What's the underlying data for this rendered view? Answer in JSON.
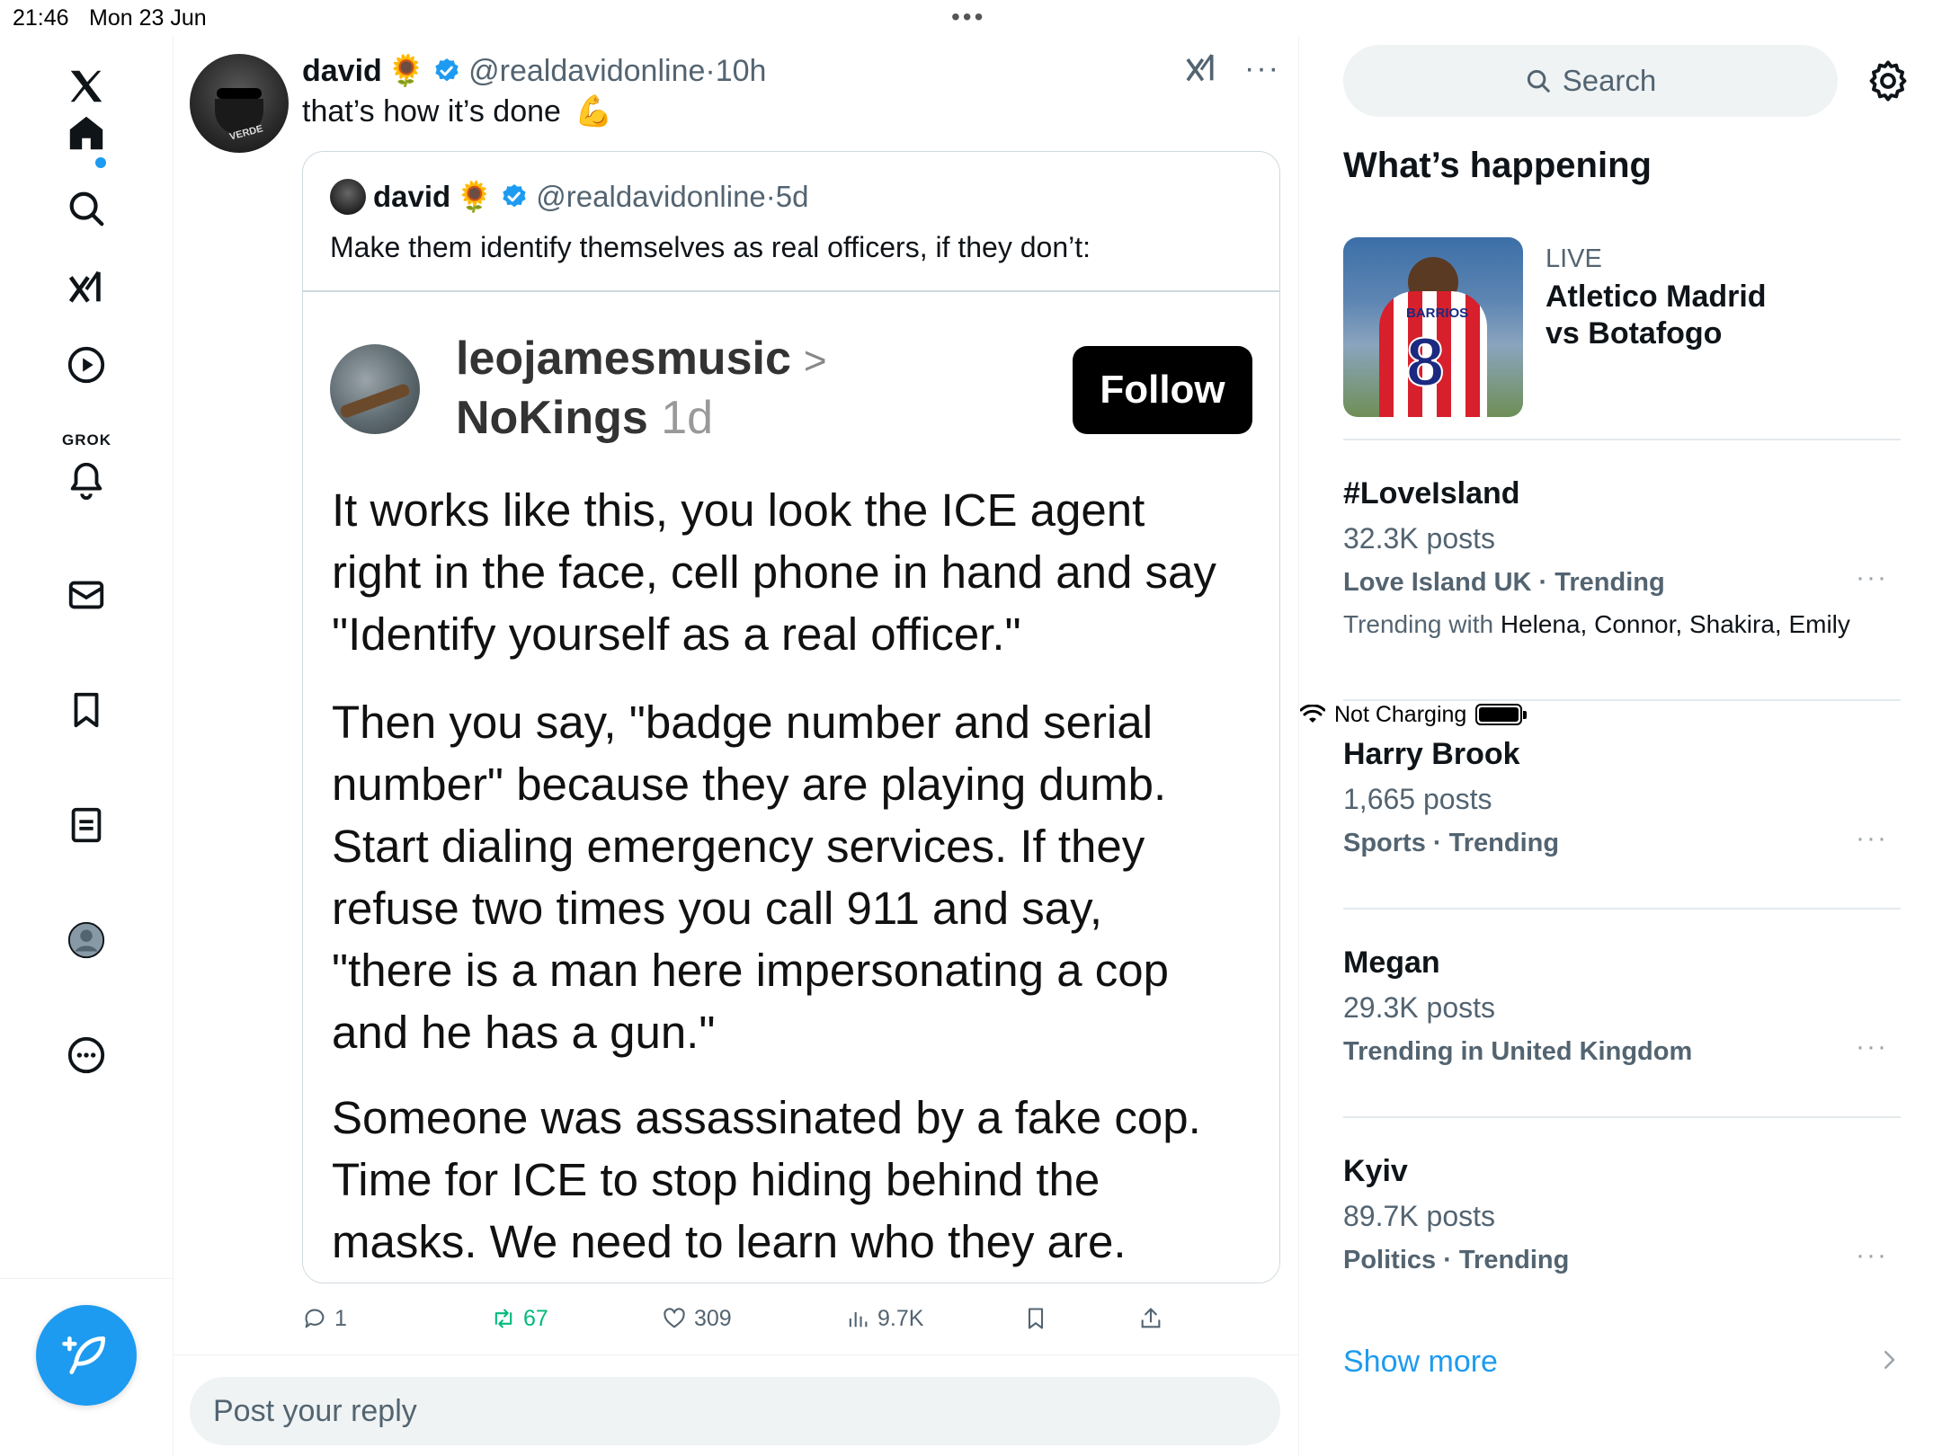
{
  "status": {
    "time": "21:46",
    "date": "Mon 23 Jun",
    "charging": "Not Charging"
  },
  "nav": {
    "grok_label": "GROK",
    "items": [
      "x-logo",
      "home-icon",
      "search-icon",
      "grok-icon",
      "video-icon",
      "notifications-icon",
      "messages-icon",
      "bookmarks-icon",
      "lists-icon",
      "profile-icon",
      "more-icon"
    ]
  },
  "post": {
    "name": "david",
    "emoji": "🌻",
    "handle": "@realdavidonline",
    "sep": "·",
    "time": "10h",
    "text": "that’s how it’s done",
    "text_emoji": "💪",
    "more": "···"
  },
  "quote": {
    "name": "david",
    "emoji": "🌻",
    "handle": "@realdavidonline",
    "sep": "·",
    "time": "5d",
    "text": "Make them identify themselves as real officers, if they don’t:",
    "screenshot": {
      "user": "leojamesmusic",
      "chevron": ">",
      "sub": "NoKings",
      "ago": "1d",
      "follow": "Follow",
      "para1": [
        "It works like this, you look the ICE agent",
        "right in the face, cell phone in hand and say",
        "\"Identify yourself as a real officer.\""
      ],
      "para2": [
        "Then you say, \"badge number and serial",
        "number\" because they are playing dumb.",
        "Start dialing emergency services. If they",
        "refuse two times you call 911 and say,",
        "\"there is a man here impersonating a cop",
        "and he has a gun.\""
      ],
      "para3": [
        "Someone was assassinated by a fake cop.",
        "Time for ICE to stop hiding behind the",
        "masks. We need to learn who they are."
      ]
    }
  },
  "actions": {
    "replies": "1",
    "reposts": "67",
    "likes": "309",
    "views": "9.7K"
  },
  "reply": {
    "placeholder": "Post your reply"
  },
  "sidebar": {
    "search_placeholder": "Search",
    "heading": "What’s happening",
    "live": {
      "label": "LIVE",
      "title_line1": "Atletico Madrid",
      "title_line2": "vs Botafogo",
      "jersey_name": "BARRIOS",
      "jersey_number": "8"
    },
    "trends": [
      {
        "title": "#LoveIsland",
        "count": "32.3K posts",
        "category": "Love Island UK · Trending",
        "with_label": "Trending with",
        "with_names": "Helena, Connor, Shakira, Emily"
      },
      {
        "title": "Harry Brook",
        "count": "1,665 posts",
        "category": "Sports · Trending"
      },
      {
        "title": "Megan",
        "count": "29.3K posts",
        "category": "Trending in United Kingdom"
      },
      {
        "title": "Kyiv",
        "count": "89.7K posts",
        "category": "Politics · Trending"
      }
    ],
    "more_dots": "···",
    "show_more": "Show more"
  },
  "colors": {
    "accent": "#1d9bf0",
    "repost_green": "#00ba7c",
    "secondary_text": "#536471"
  }
}
